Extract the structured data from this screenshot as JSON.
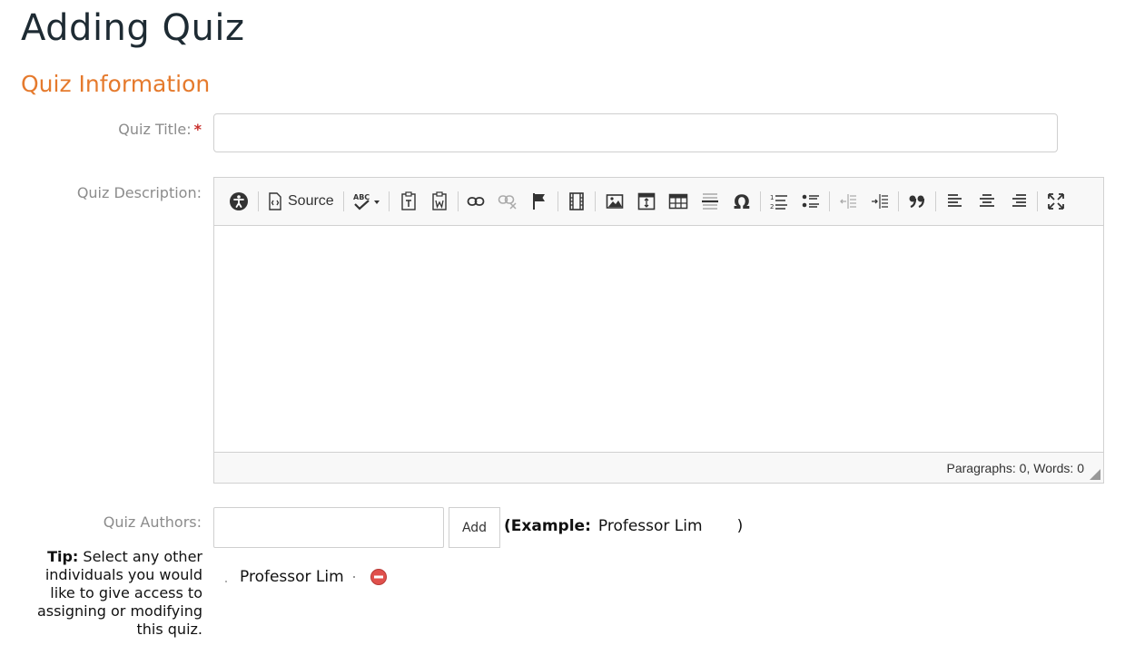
{
  "page": {
    "title": "Adding Quiz",
    "section_title": "Quiz Information"
  },
  "form": {
    "quiz_title": {
      "label": "Quiz Title:",
      "required_mark": "*",
      "value": ""
    },
    "quiz_description": {
      "label": "Quiz Description:",
      "toolbar": {
        "source_label": "Source",
        "buttons": [
          "accessibility-icon",
          "source-icon",
          "spellcheck-icon",
          "paste-text-icon",
          "paste-word-icon",
          "link-icon",
          "unlink-icon",
          "anchor-flag-icon",
          "video-icon",
          "image-icon",
          "template-icon",
          "table-icon",
          "horizontal-rule-icon",
          "special-char-icon",
          "numbered-list-icon",
          "bulleted-list-icon",
          "outdent-icon",
          "indent-icon",
          "blockquote-icon",
          "align-left-icon",
          "align-center-icon",
          "align-right-icon",
          "maximize-icon"
        ]
      },
      "word_count": "Paragraphs: 0, Words: 0"
    },
    "quiz_authors": {
      "label": "Quiz Authors:",
      "input_value": "",
      "add_label": "Add",
      "example_open": "(",
      "example_label": "Example:",
      "example_name": "Professor Lim",
      "example_close": ")",
      "tip_label": "Tip:",
      "tip_text": "Select any other individuals you would like to give access to assigning or modifying this quiz.",
      "authors": [
        {
          "name": "Professor Lim"
        }
      ]
    }
  },
  "colors": {
    "heading": "#1e2b33",
    "section": "#e57a2d",
    "label": "#8c8c8c",
    "required": "#c9302c",
    "remove": "#e0504c"
  }
}
